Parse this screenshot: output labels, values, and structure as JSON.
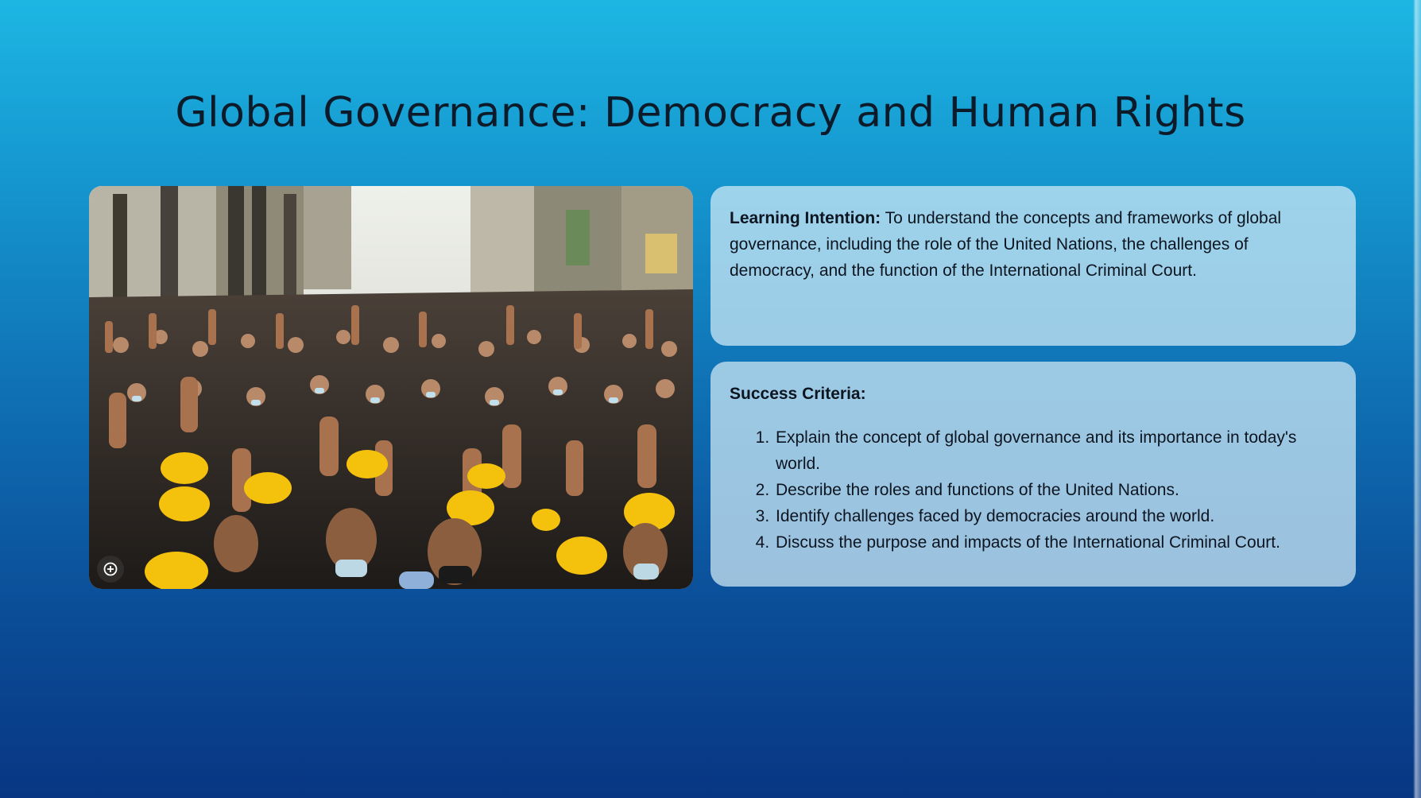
{
  "slide": {
    "title": "Global Governance: Democracy and Human Rights",
    "image": {
      "icon": "zoom-in-icon"
    },
    "learning_intention": {
      "label": "Learning Intention:",
      "text": " To understand the concepts and frameworks of global governance, including the role of the United Nations, the challenges of democracy, and the function of the International Criminal Court."
    },
    "success_criteria": {
      "label": "Success Criteria:",
      "items": [
        "Explain the concept of global governance and its importance in today's world.",
        "Describe the roles and functions of the United Nations.",
        "Identify challenges faced by democracies around the world.",
        "Discuss the purpose and impacts of the International Criminal Court."
      ]
    }
  },
  "colors": {
    "background_top": "#1db6e3",
    "background_bottom": "#083683",
    "card": "#d2ebf6",
    "title_text": "#0c1b2a",
    "helmet_yellow": "#f4c20d"
  }
}
